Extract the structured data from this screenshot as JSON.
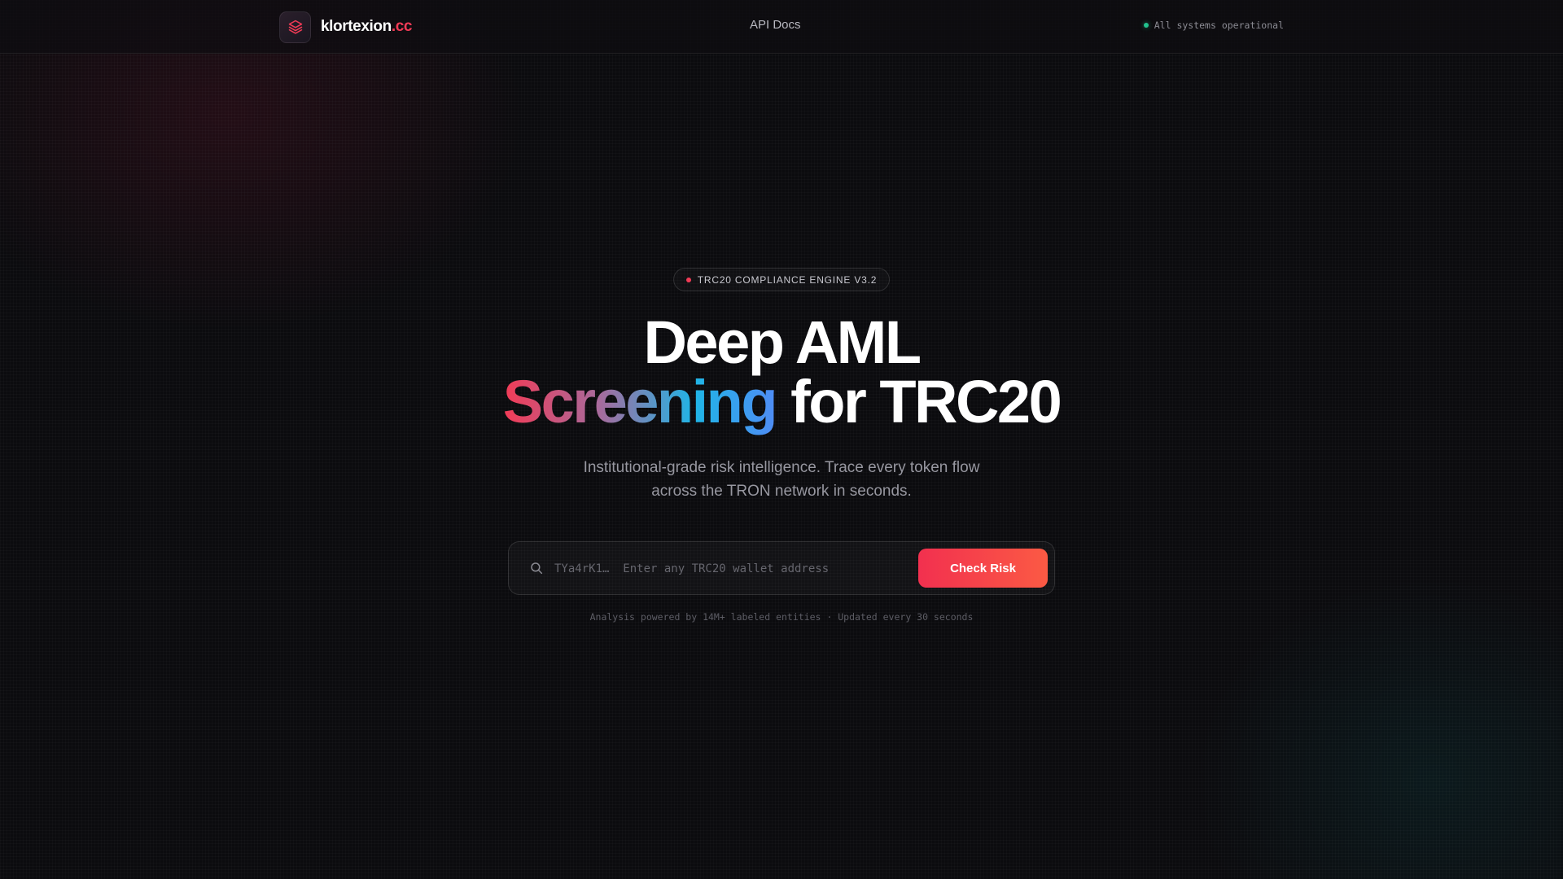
{
  "colors": {
    "background": "#0b0b0e",
    "accent": "#f23b56",
    "status_ok": "#22c38e",
    "button_gradient": [
      "#f2304f",
      "#fb5a44"
    ],
    "headline_gradient": [
      "#f23b56",
      "#a86a9c",
      "#1fb5e6",
      "#4f8cf5"
    ]
  },
  "header": {
    "brand_icon": "layers-icon",
    "brand_name": "klortexion",
    "brand_tld": ".cc",
    "nav_link": "API Docs",
    "status_text": "All systems operational"
  },
  "hero": {
    "badge": "TRC20 COMPLIANCE ENGINE V3.2",
    "headline_line1": "Deep AML",
    "headline_highlight": "Screening",
    "headline_rest": "for TRC20",
    "subtitle_line1": "Institutional-grade risk intelligence. Trace every token flow",
    "subtitle_line2": "across the TRON network in seconds."
  },
  "search": {
    "icon": "search-icon",
    "placeholder": "TYa4rK1…  Enter any TRC20 wallet address",
    "value": "",
    "button_label": "Check Risk"
  },
  "footnote": "Analysis powered by 14M+ labeled entities · Updated every 30 seconds"
}
